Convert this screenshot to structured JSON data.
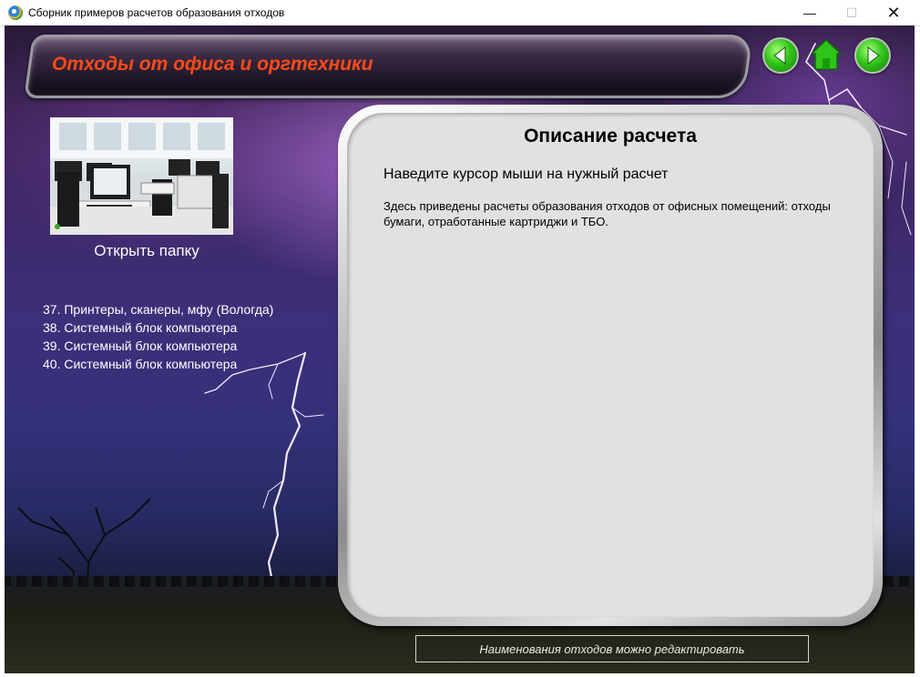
{
  "window": {
    "title": "Сборник примеров расчетов образования отходов",
    "minimize_symbol": "—",
    "maximize_symbol": "☐",
    "close_symbol": "✕"
  },
  "header": {
    "title": "Отходы от офиса и оргтехники"
  },
  "nav": {
    "back_icon": "arrow-left-icon",
    "home_icon": "home-icon",
    "forward_icon": "arrow-right-icon",
    "color": "#2fc41a"
  },
  "left_panel": {
    "thumbnail_icon": "office-computers-image",
    "open_folder_label": "Открыть папку",
    "items": [
      {
        "label": "37. Принтеры, сканеры, мфу (Вологда)"
      },
      {
        "label": "38. Системный блок компьютера"
      },
      {
        "label": "39. Системный блок компьютера"
      },
      {
        "label": "40. Системный блок компьютера"
      }
    ]
  },
  "description": {
    "title": "Описание расчета",
    "hint": "Наведите курсор мыши на нужный расчет",
    "text": "Здесь приведены расчеты образования отходов от офисных помещений: отходы бумаги, отработанные картриджи и ТБО."
  },
  "footer": {
    "note": "Наименования отходов можно редактировать"
  },
  "colors": {
    "header_title": "#ff4b17",
    "panel_bg": "#e1e1e1"
  }
}
